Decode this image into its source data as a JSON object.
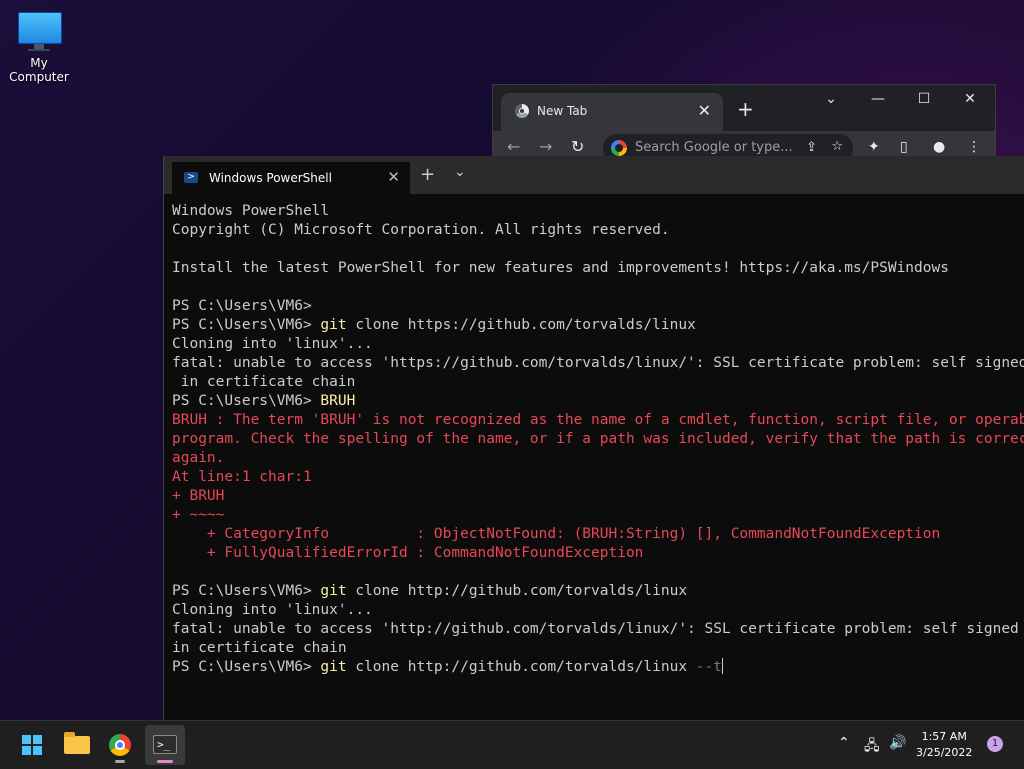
{
  "desktop": {
    "icons": [
      {
        "label": "My Computer",
        "icon": "computer-icon"
      }
    ]
  },
  "chrome": {
    "tab_title": "New Tab",
    "tab_close": "✕",
    "new_tab": "+",
    "minimize_glyph": "—",
    "maximize_glyph": "☐",
    "close_glyph": "✕",
    "tab_search_glyph": "⌄",
    "back_glyph": "←",
    "forward_glyph": "→",
    "reload_glyph": "↻",
    "omnibox_placeholder": "Search Google or type...",
    "share_glyph": "⇪",
    "star_glyph": "☆",
    "extensions_glyph": "✦",
    "sidepanel_glyph": "▯",
    "profile_glyph": "●",
    "menu_glyph": "⋮"
  },
  "terminal": {
    "tab_title": "Windows PowerShell",
    "tab_close": "✕",
    "new_tab": "+",
    "dropdown": "⌄",
    "lines": [
      {
        "text": "Windows PowerShell",
        "type": "normal"
      },
      {
        "text": "Copyright (C) Microsoft Corporation. All rights reserved.",
        "type": "normal"
      },
      {
        "text": "",
        "type": "normal"
      },
      {
        "text": "Install the latest PowerShell for new features and improvements! https://aka.ms/PSWindows",
        "type": "normal"
      },
      {
        "text": "",
        "type": "normal"
      },
      {
        "text": "PS C:\\Users\\VM6>",
        "type": "normal"
      },
      {
        "text": "PS C:\\Users\\VM6> ",
        "cmd": "git",
        "rest": " clone https://github.com/torvalds/linux",
        "type": "prompt"
      },
      {
        "text": "Cloning into 'linux'...",
        "type": "normal"
      },
      {
        "text": "fatal: unable to access 'https://github.com/torvalds/linux/': SSL certificate problem: self signed certificate",
        "type": "normal"
      },
      {
        "text": " in certificate chain",
        "type": "normal"
      },
      {
        "text": "PS C:\\Users\\VM6> ",
        "cmd": "BRUH",
        "rest": "",
        "type": "prompt"
      },
      {
        "text": "BRUH : The term 'BRUH' is not recognized as the name of a cmdlet, function, script file, or operable",
        "type": "error"
      },
      {
        "text": "program. Check the spelling of the name, or if a path was included, verify that the path is correct and try",
        "type": "error"
      },
      {
        "text": "again.",
        "type": "error"
      },
      {
        "text": "At line:1 char:1",
        "type": "error"
      },
      {
        "text": "+ BRUH",
        "type": "error"
      },
      {
        "text": "+ ~~~~",
        "type": "error"
      },
      {
        "text": "    + CategoryInfo          : ObjectNotFound: (BRUH:String) [], CommandNotFoundException",
        "type": "error"
      },
      {
        "text": "    + FullyQualifiedErrorId : CommandNotFoundException",
        "type": "error"
      },
      {
        "text": "",
        "type": "normal"
      },
      {
        "text": "PS C:\\Users\\VM6> ",
        "cmd": "git",
        "rest": " clone http://github.com/torvalds/linux",
        "type": "prompt"
      },
      {
        "text": "Cloning into 'linux'...",
        "type": "normal"
      },
      {
        "text": "fatal: unable to access 'http://github.com/torvalds/linux/': SSL certificate problem: self signed certificate",
        "type": "normal"
      },
      {
        "text": "in certificate chain",
        "type": "normal"
      },
      {
        "text": "PS C:\\Users\\VM6> ",
        "cmd": "git",
        "rest": " clone http://github.com/torvalds/linux ",
        "flag": "--t",
        "type": "current"
      }
    ]
  },
  "taskbar": {
    "items": [
      {
        "name": "start-button",
        "icon": "windows-logo-icon"
      },
      {
        "name": "file-explorer-button",
        "icon": "folder-icon"
      },
      {
        "name": "chrome-button",
        "icon": "chrome-icon"
      },
      {
        "name": "terminal-button",
        "icon": "terminal-icon"
      }
    ],
    "tray_chevron": "⌃",
    "tray_network": "🖧",
    "tray_volume": "🔊",
    "time": "1:57 AM",
    "date": "3/25/2022",
    "notification_count": "1"
  }
}
